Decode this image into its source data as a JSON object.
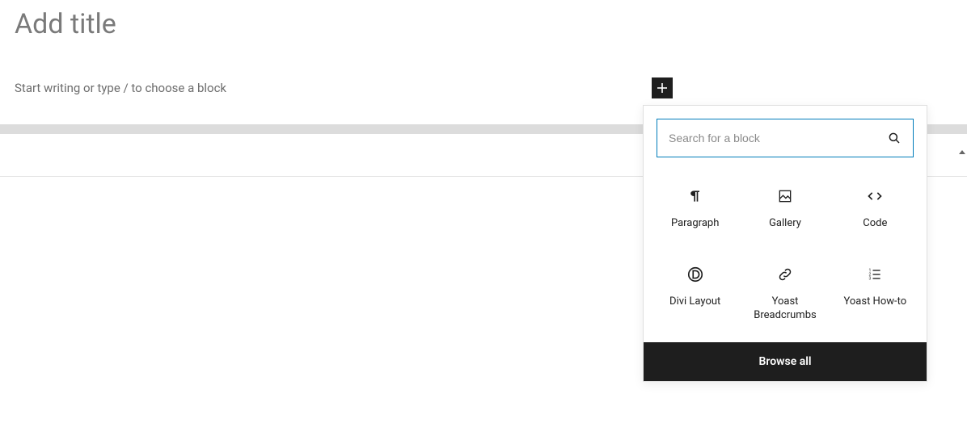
{
  "title": {
    "placeholder": "Add title"
  },
  "editor": {
    "placeholder": "Start writing or type / to choose a block"
  },
  "search": {
    "placeholder": "Search for a block"
  },
  "blocks": {
    "paragraph": "Paragraph",
    "gallery": "Gallery",
    "code": "Code",
    "divi": "Divi Layout",
    "yoast_breadcrumbs": "Yoast Breadcrumbs",
    "yoast_howto": "Yoast How-to"
  },
  "browse_all": "Browse all"
}
